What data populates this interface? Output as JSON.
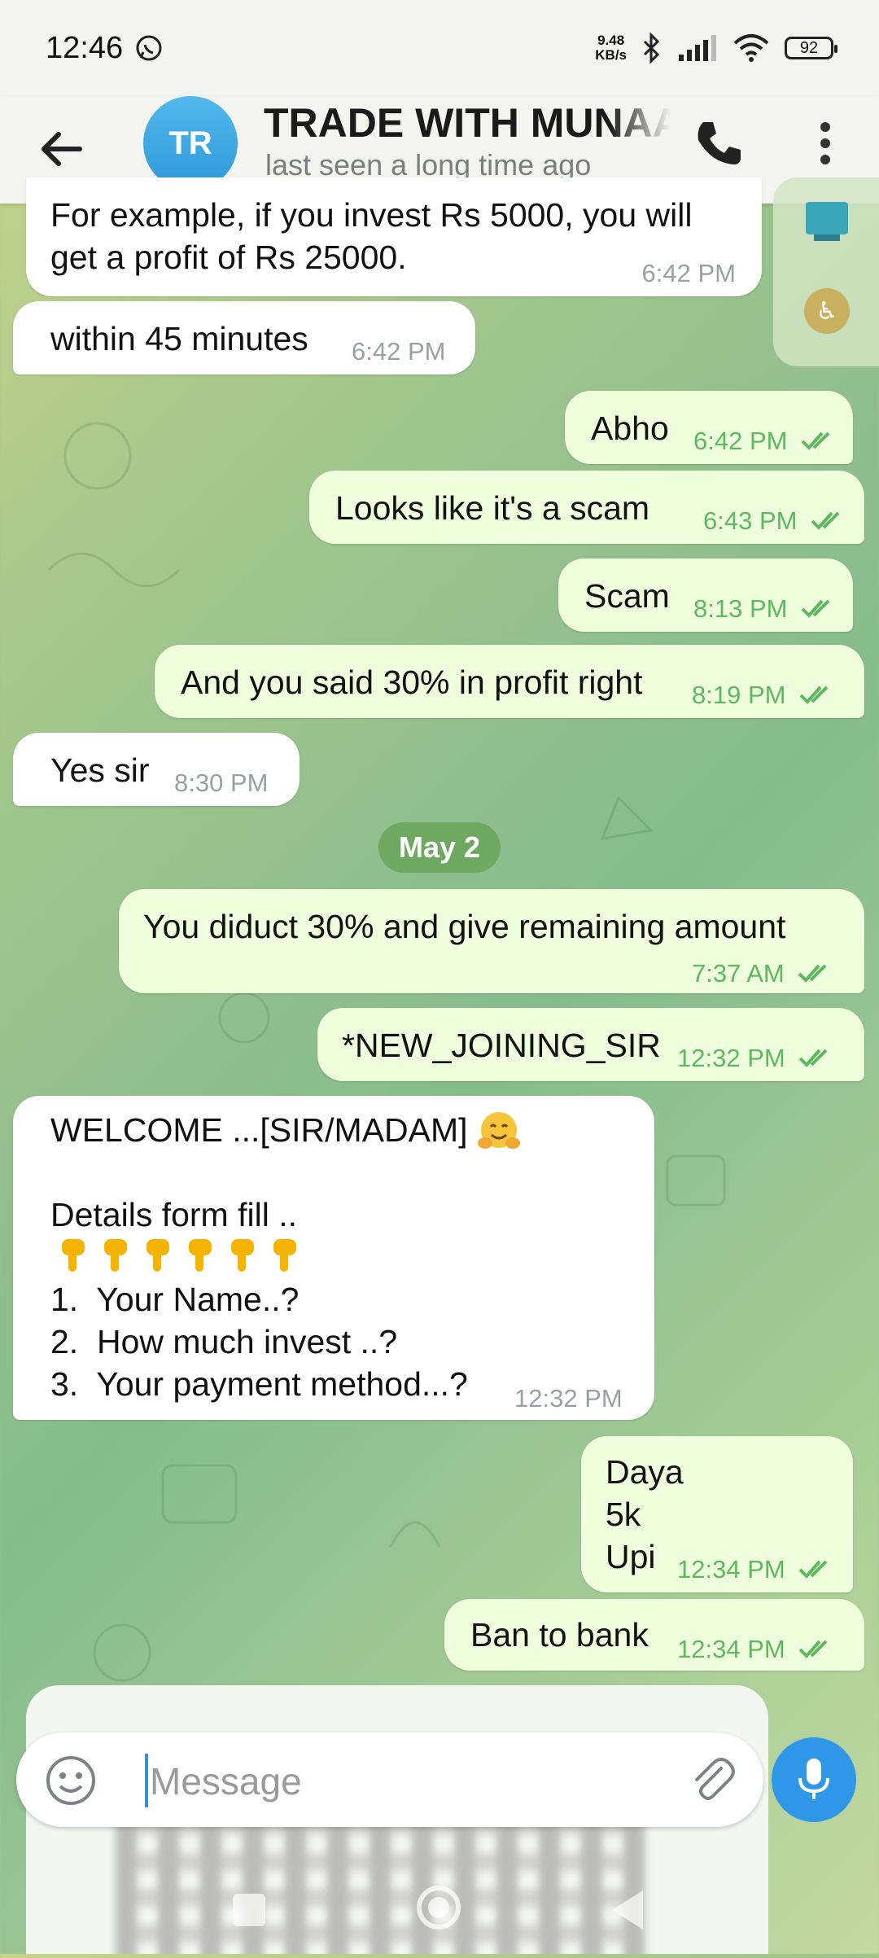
{
  "status_bar": {
    "time": "12:46",
    "net_speed_value": "9.48",
    "net_speed_unit": "KB/s",
    "battery": "92"
  },
  "header": {
    "avatar_initials": "TR",
    "title": "TRADE WITH MUNAAR",
    "subtitle": "last seen a long time ago"
  },
  "messages": [
    {
      "direction": "in",
      "lines": [
        "For example, if you invest Rs 5000, you will",
        "get a profit of Rs 25000."
      ],
      "time": "6:42 PM"
    },
    {
      "direction": "in",
      "text": "within 45 minutes",
      "time": "6:42 PM"
    },
    {
      "direction": "out",
      "text": "Abho",
      "time": "6:42 PM",
      "read": true
    },
    {
      "direction": "out",
      "text": "Looks like it's a scam",
      "time": "6:43 PM",
      "read": true
    },
    {
      "direction": "out",
      "text": "Scam",
      "time": "8:13 PM",
      "read": true
    },
    {
      "direction": "out",
      "text": "And you said 30% in profit right",
      "time": "8:19 PM",
      "read": true
    },
    {
      "direction": "in",
      "text": "Yes sir",
      "time": "8:30 PM"
    },
    {
      "direction": "out",
      "text": "You diduct 30% and give remaining amount",
      "time": "7:37 AM",
      "read": true
    },
    {
      "direction": "out",
      "text": "*NEW_JOINING_SIR",
      "time": "12:32 PM",
      "read": true
    },
    {
      "direction": "in",
      "lines": [
        "WELCOME ...[SIR/MADAM]",
        "",
        "Details form fill ..",
        "",
        "1.  Your Name..?",
        "2.  How much invest ..?",
        "3.  Your payment method...?"
      ],
      "time": "12:32 PM"
    },
    {
      "direction": "out",
      "lines": [
        "Daya",
        "5k",
        "Upi"
      ],
      "time": "12:34 PM",
      "read": true
    },
    {
      "direction": "out",
      "text": "Ban to bank",
      "time": "12:34 PM",
      "read": true
    }
  ],
  "date_divider": "May 2",
  "composer": {
    "placeholder": "Message"
  },
  "icons": [
    "back-arrow-icon",
    "phone-icon",
    "more-vert-icon",
    "emoji-icon",
    "attach-icon",
    "mic-icon",
    "double-check-icon",
    "pointing-down-emoji",
    "hugging-face-emoji"
  ],
  "colors": {
    "header_bg": "#f3f4f0",
    "incoming_bubble": "#ffffff",
    "outgoing_bubble": "#efffde",
    "check_color": "#5eb860",
    "accent": "#2e97e8"
  }
}
